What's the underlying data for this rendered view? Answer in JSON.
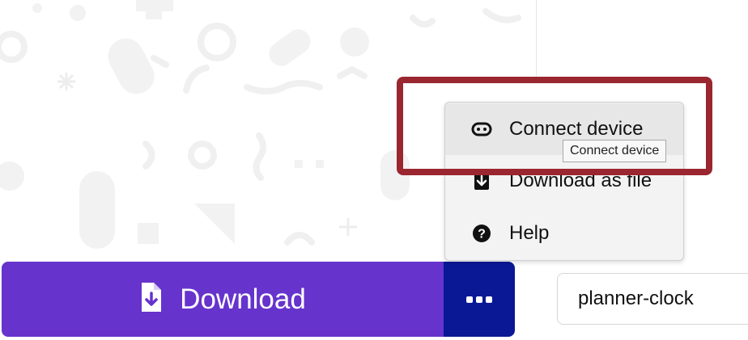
{
  "download_button": {
    "label": "Download",
    "icon": "file-download-icon",
    "color": "#6633cc"
  },
  "more_button": {
    "icon": "more-dots-icon",
    "color": "#0a1896"
  },
  "project_name": {
    "value": "planner-clock"
  },
  "menu": {
    "items": [
      {
        "label": "Connect device",
        "icon": "microbit-device-icon",
        "active": true
      },
      {
        "label": "Download as file",
        "icon": "download-file-icon",
        "active": false
      },
      {
        "label": "Help",
        "icon": "help-icon",
        "active": false
      }
    ]
  },
  "tooltip": {
    "text": "Connect device"
  },
  "highlight": {
    "color": "#9a2630"
  }
}
